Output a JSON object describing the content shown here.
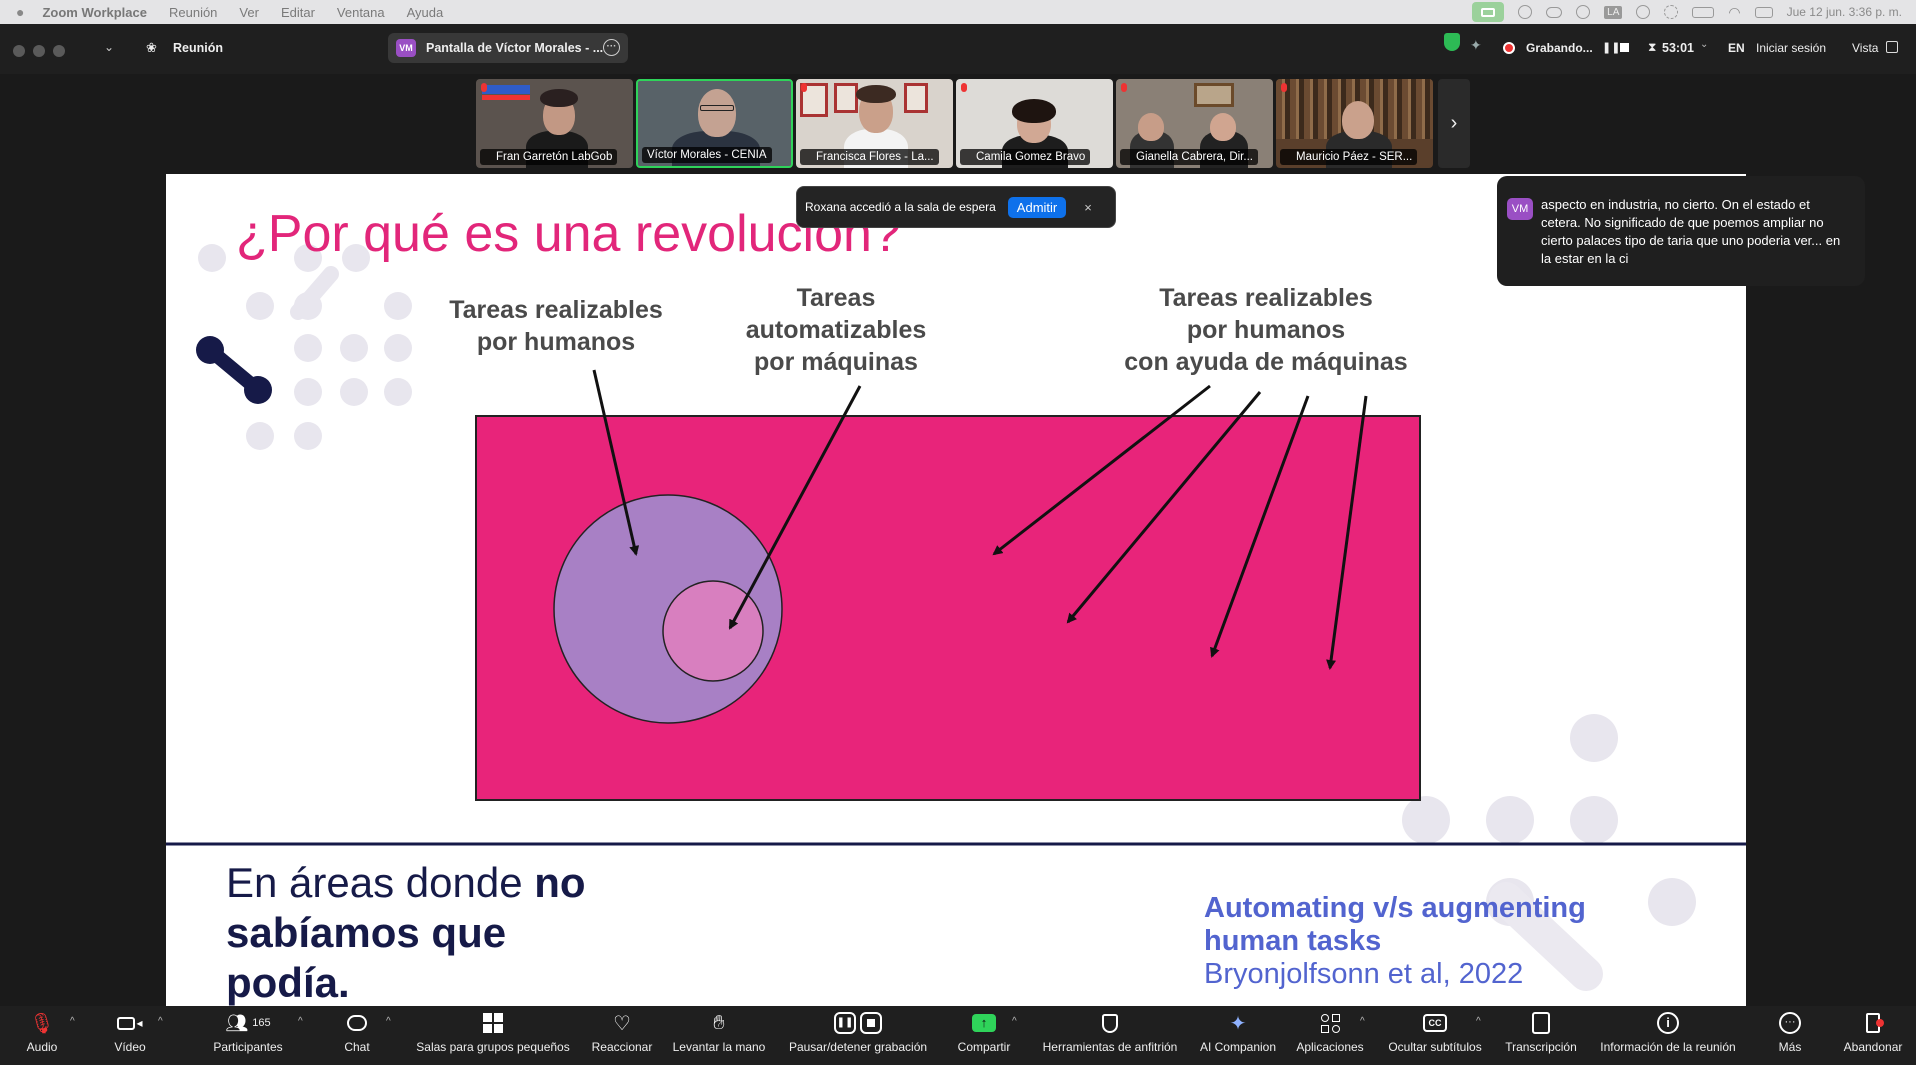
{
  "menubar": {
    "app": "Zoom Workplace",
    "items": [
      "Reunión",
      "Ver",
      "Editar",
      "Ventana",
      "Ayuda"
    ],
    "clock": "Jue 12 jun.  3:36 p. m.",
    "user_badge": "LA"
  },
  "titlebar": {
    "meeting_label": "Reunión",
    "share_tab_badge": "VM",
    "share_tab_label": "Pantalla de Víctor Morales - ...",
    "recording": "Grabando...",
    "timer": "53:01",
    "lang": "EN",
    "signin": "Iniciar sesión",
    "view": "Vista"
  },
  "participants": [
    {
      "name": "Fran Garretón LabGob"
    },
    {
      "name": "Víctor Morales - CENIA"
    },
    {
      "name": "Francisca Flores - La..."
    },
    {
      "name": "Camila Gomez Bravo"
    },
    {
      "name": "Gianella Cabrera, Dir..."
    },
    {
      "name": "Mauricio Páez - SER..."
    }
  ],
  "waiting": {
    "text": "Roxana accedió a la sala de espera",
    "button": "Admitir",
    "close": "×"
  },
  "caption": {
    "badge": "VM",
    "text": "aspecto en industria, no cierto. On el estado et cetera. No significado de que poemos ampliar no cierto palaces tipo de taria que uno poderia ver... en la estar en la ci"
  },
  "slide": {
    "title": "¿Por qué es una revolución?",
    "label_humans": [
      "Tareas realizables",
      "por humanos"
    ],
    "label_machines": [
      "Tareas",
      "automatizables",
      "por máquinas"
    ],
    "label_assisted": [
      "Tareas realizables",
      "por humanos",
      "con ayuda de máquinas"
    ],
    "bottom_left_1": "En áreas donde ",
    "bottom_left_bold1": "no",
    "bottom_left_bold2": "sabíamos que",
    "bottom_left_bold3": "podía.",
    "ref_title_1": "Automating v/s augmenting",
    "ref_title_2": "human tasks",
    "ref_author": "Bryonjolfsonn et al, 2022",
    "colors": {
      "title": "#e2267a",
      "rect": "#e8247a",
      "big_circle": "#a880c5",
      "small_circle": "#d87fbf",
      "navy": "#161a48",
      "ref": "#5264cf"
    }
  },
  "toolbar": {
    "audio": "Audio",
    "video": "Vídeo",
    "participants": "Participantes",
    "participants_count": "165",
    "chat": "Chat",
    "breakout": "Salas para grupos pequeños",
    "react": "Reaccionar",
    "raise_hand": "Levantar la mano",
    "pause_rec": "Pausar/detener grabación",
    "share": "Compartir",
    "host_tools": "Herramientas de anfitrión",
    "ai": "AI Companion",
    "apps": "Aplicaciones",
    "captions": "Ocultar subtítulos",
    "transcript": "Transcripción",
    "info": "Información de la reunión",
    "more": "Más",
    "leave": "Abandonar"
  }
}
